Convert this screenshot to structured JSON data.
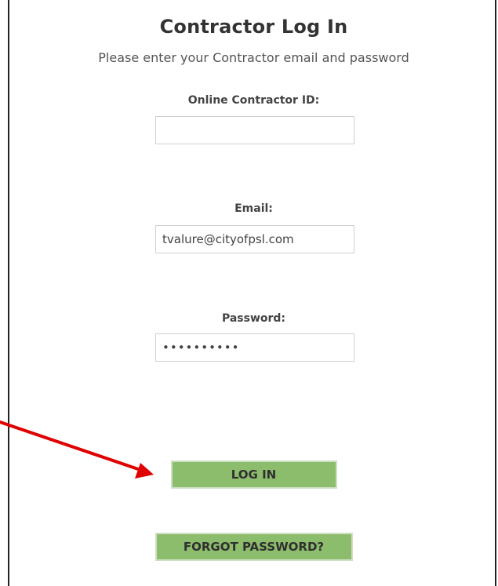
{
  "header": {
    "title": "Contractor Log In",
    "subtitle": "Please enter your Contractor email and password"
  },
  "form": {
    "contractor_id": {
      "label": "Online Contractor ID:",
      "value": ""
    },
    "email": {
      "label": "Email:",
      "value": "tvalure@cityofpsl.com"
    },
    "password": {
      "label": "Password:",
      "value": "••••••••••"
    }
  },
  "actions": {
    "login_label": "LOG IN",
    "forgot_label": "FORGOT PASSWORD?"
  },
  "colors": {
    "button_green": "#8cbd6c",
    "annotation_arrow": "#e00000"
  }
}
